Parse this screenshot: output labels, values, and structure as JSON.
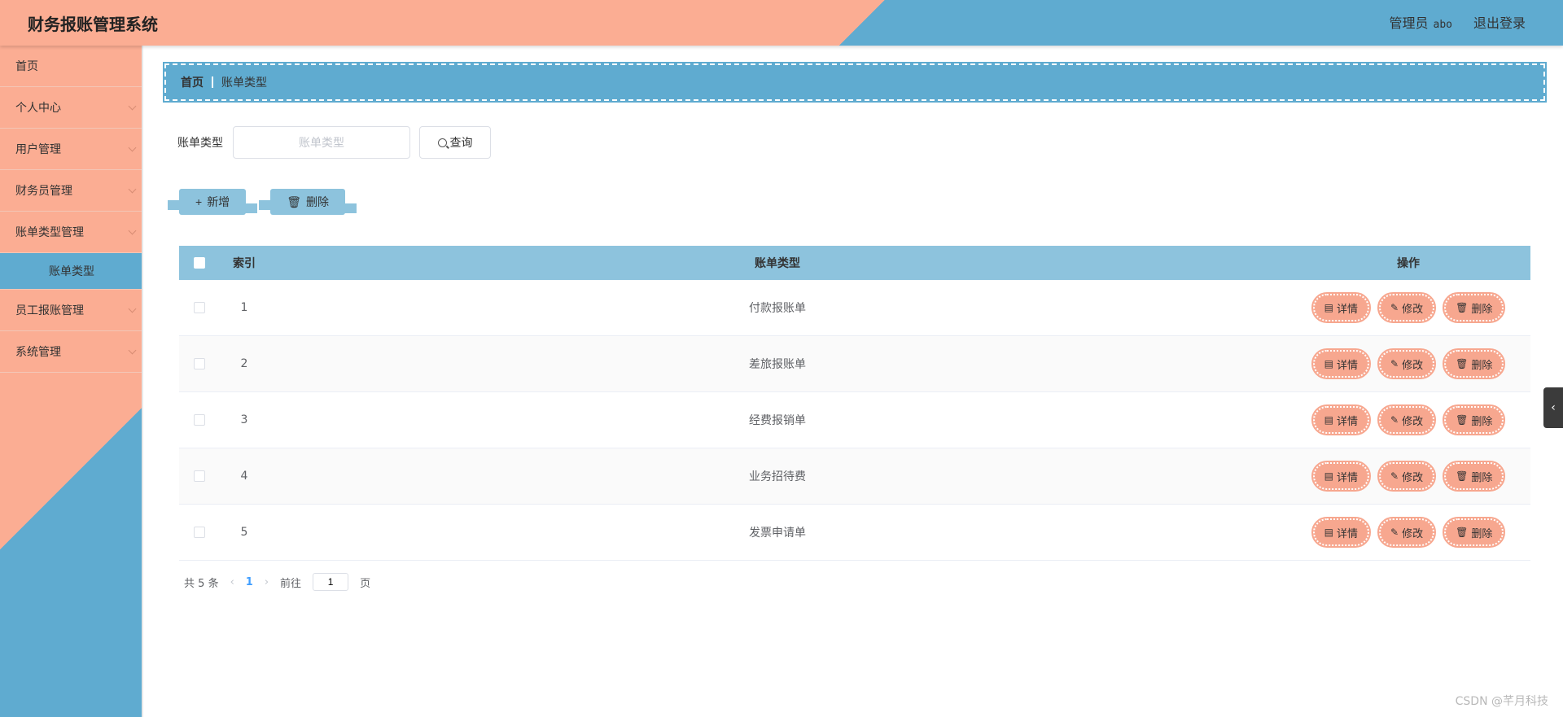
{
  "app": {
    "title": "财务报账管理系统"
  },
  "header": {
    "role": "管理员",
    "username": "abo",
    "logout": "退出登录"
  },
  "sidebar": {
    "items": [
      {
        "label": "首页",
        "expandable": false
      },
      {
        "label": "个人中心",
        "expandable": true
      },
      {
        "label": "用户管理",
        "expandable": true
      },
      {
        "label": "财务员管理",
        "expandable": true
      },
      {
        "label": "账单类型管理",
        "expandable": true
      },
      {
        "label": "账单类型",
        "sub": true
      },
      {
        "label": "员工报账管理",
        "expandable": true
      },
      {
        "label": "系统管理",
        "expandable": true
      }
    ]
  },
  "breadcrumb": {
    "home": "首页",
    "current": "账单类型"
  },
  "search": {
    "label": "账单类型",
    "placeholder": "账单类型",
    "value": "",
    "button": "查询"
  },
  "actions": {
    "add": "新增",
    "delete": "删除"
  },
  "table": {
    "headers": {
      "index": "索引",
      "type": "账单类型",
      "ops": "操作"
    },
    "rows": [
      {
        "index": "1",
        "type": "付款报账单"
      },
      {
        "index": "2",
        "type": "差旅报账单"
      },
      {
        "index": "3",
        "type": "经费报销单"
      },
      {
        "index": "4",
        "type": "业务招待费"
      },
      {
        "index": "5",
        "type": "发票申请单"
      }
    ],
    "ops": {
      "detail": "详情",
      "edit": "修改",
      "delete": "删除"
    }
  },
  "pager": {
    "total_prefix": "共",
    "total": "5",
    "total_suffix": "条",
    "current_page": "1",
    "goto_label": "前往",
    "goto_value": "1",
    "page_suffix": "页"
  },
  "watermark": "CSDN @芊月科技",
  "colors": {
    "salmon": "#fbad93",
    "blue": "#5fabd0",
    "table_header": "#8dc3dd",
    "op_button": "#f7a78f"
  }
}
